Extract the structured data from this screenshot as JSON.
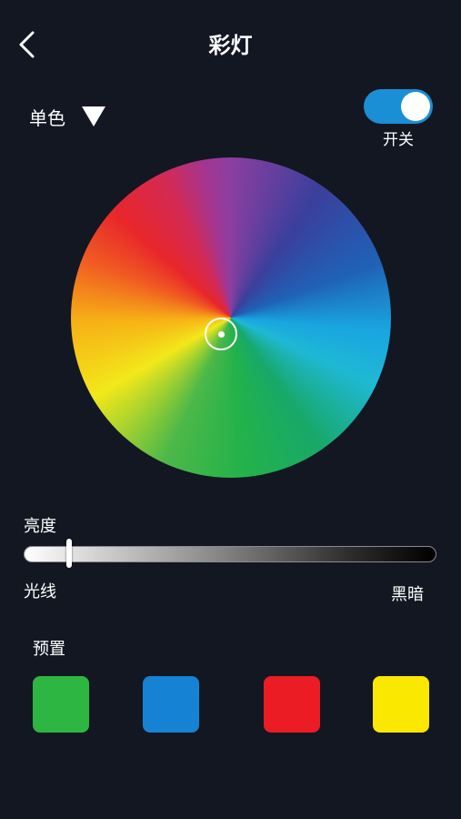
{
  "header": {
    "title": "彩灯"
  },
  "mode": {
    "label": "单色"
  },
  "power": {
    "label": "开关",
    "on": true,
    "color": "#1a8fd6"
  },
  "brightness": {
    "title": "亮度",
    "min_label": "光线",
    "max_label": "黑暗",
    "value_fraction": 0.11
  },
  "presets": {
    "title": "预置",
    "colors": [
      "#2db742",
      "#1682d4",
      "#ec1c24",
      "#fbe800"
    ]
  },
  "icons": {
    "back": "back-arrow-icon",
    "dropdown": "triangle-down-icon"
  }
}
